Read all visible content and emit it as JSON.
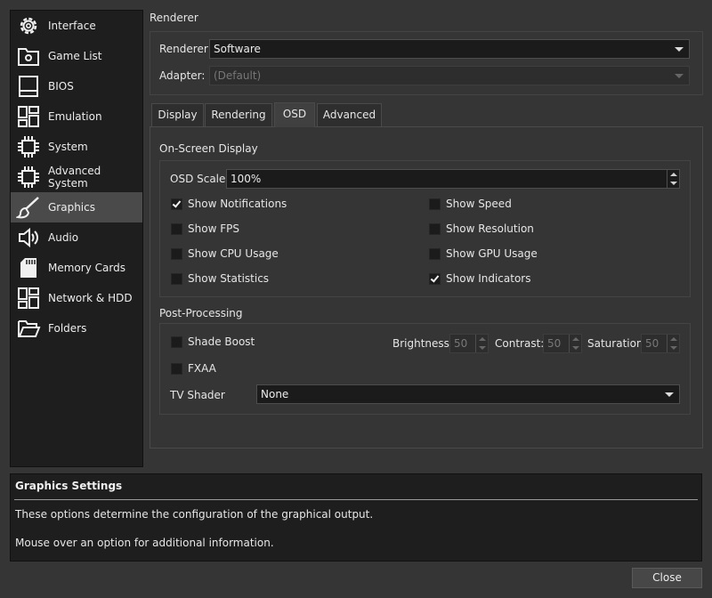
{
  "sidebar": {
    "items": [
      {
        "label": "Interface",
        "icon": "gear-icon"
      },
      {
        "label": "Game List",
        "icon": "folder-settings-icon"
      },
      {
        "label": "BIOS",
        "icon": "monitor-icon"
      },
      {
        "label": "Emulation",
        "icon": "dashboard-icon"
      },
      {
        "label": "System",
        "icon": "chip-icon"
      },
      {
        "label": "Advanced System",
        "icon": "chip-icon"
      },
      {
        "label": "Graphics",
        "icon": "brush-icon"
      },
      {
        "label": "Audio",
        "icon": "speaker-icon"
      },
      {
        "label": "Memory Cards",
        "icon": "sd-card-icon"
      },
      {
        "label": "Network & HDD",
        "icon": "dashboard-icon"
      },
      {
        "label": "Folders",
        "icon": "folder-open-icon"
      }
    ],
    "active": "Graphics"
  },
  "renderer": {
    "title": "Renderer",
    "renderer_label": "Renderer:",
    "renderer_value": "Software",
    "adapter_label": "Adapter:",
    "adapter_value": "(Default)"
  },
  "tabs": [
    {
      "label": "Display"
    },
    {
      "label": "Rendering"
    },
    {
      "label": "OSD"
    },
    {
      "label": "Advanced"
    }
  ],
  "active_tab": "OSD",
  "osd": {
    "title": "On-Screen Display",
    "scale_label": "OSD Scale:",
    "scale_value": "100%",
    "checks": [
      {
        "label": "Show Notifications",
        "checked": true
      },
      {
        "label": "Show Speed",
        "checked": false
      },
      {
        "label": "Show FPS",
        "checked": false
      },
      {
        "label": "Show Resolution",
        "checked": false
      },
      {
        "label": "Show CPU Usage",
        "checked": false
      },
      {
        "label": "Show GPU Usage",
        "checked": false
      },
      {
        "label": "Show Statistics",
        "checked": false
      },
      {
        "label": "Show Indicators",
        "checked": true
      }
    ]
  },
  "post": {
    "title": "Post-Processing",
    "shade_boost_label": "Shade Boost",
    "fxaa_label": "FXAA",
    "brightness_label": "Brightness:",
    "brightness_value": "50",
    "contrast_label": "Contrast:",
    "contrast_value": "50",
    "saturation_label": "Saturation",
    "saturation_value": "50",
    "tv_shader_label": "TV Shader",
    "tv_shader_value": "None"
  },
  "help": {
    "title": "Graphics Settings",
    "line1": "These options determine the configuration of the graphical output.",
    "line2": "Mouse over an option for additional information."
  },
  "close_label": "Close"
}
